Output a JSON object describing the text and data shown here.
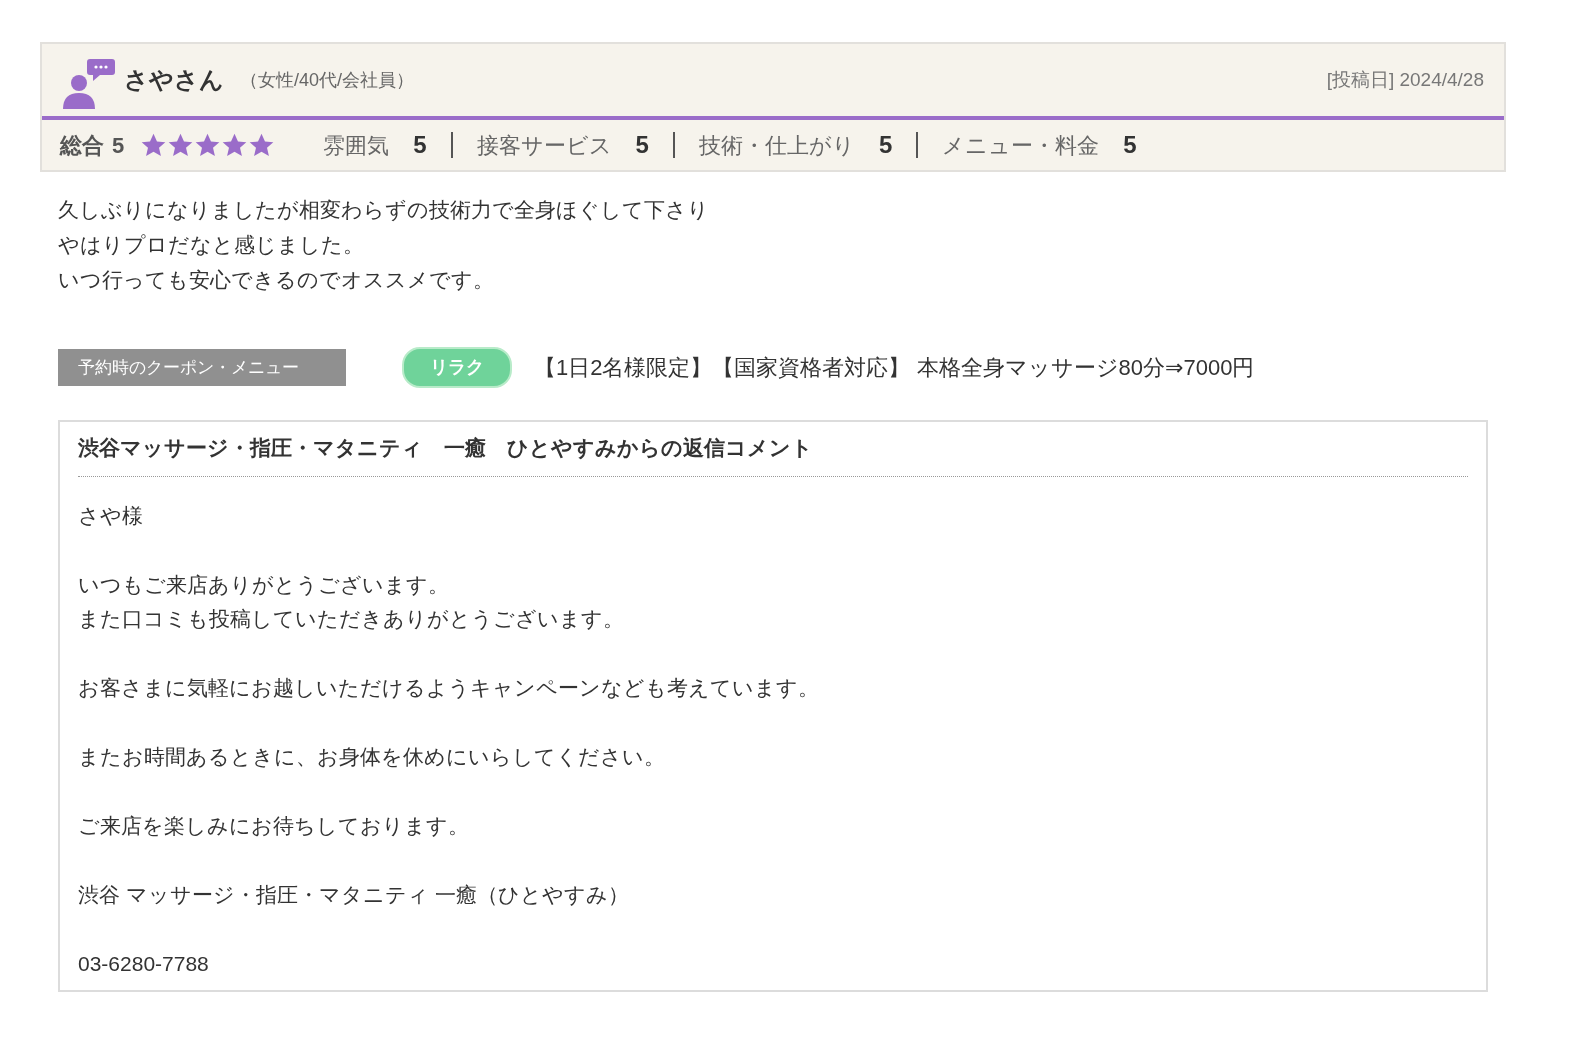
{
  "review": {
    "reviewer_name": "さやさん",
    "reviewer_profile": "（女性/40代/会社員）",
    "posted_date": "[投稿日] 2024/4/28",
    "overall": {
      "label": "総合",
      "score": "5",
      "stars": 5
    },
    "ratings": [
      {
        "label": "雰囲気",
        "score": "5"
      },
      {
        "label": "接客サービス",
        "score": "5"
      },
      {
        "label": "技術・仕上がり",
        "score": "5"
      },
      {
        "label": "メニュー・料金",
        "score": "5"
      }
    ],
    "body_lines": [
      "久しぶりになりましたが相変わらずの技術力で全身ほぐして下さり",
      "やはりプロだなと感じました。",
      "いつ行っても安心できるのでオススメです。"
    ],
    "coupon": {
      "label": "予約時のクーポン・メニュー",
      "tag": "リラク",
      "text": "【1日2名様限定】【国家資格者対応】 本格全身マッサージ80分⇒7000円"
    }
  },
  "reply": {
    "title": "渋谷マッサージ・指圧・マタニティ　一癒　ひとやすみからの返信コメント",
    "paragraphs": [
      [
        "さや様"
      ],
      [
        "いつもご来店ありがとうございます。",
        "また口コミも投稿していただきありがとうございます。"
      ],
      [
        "お客さまに気軽にお越しいただけるようキャンペーンなども考えています。"
      ],
      [
        "またお時間あるときに、お身体を休めにいらしてください。"
      ],
      [
        "ご来店を楽しみにお待ちしております。"
      ],
      [
        "渋谷 マッサージ・指圧・マタニティ 一癒（ひとやすみ）"
      ],
      [
        "03-6280-7788"
      ]
    ]
  }
}
